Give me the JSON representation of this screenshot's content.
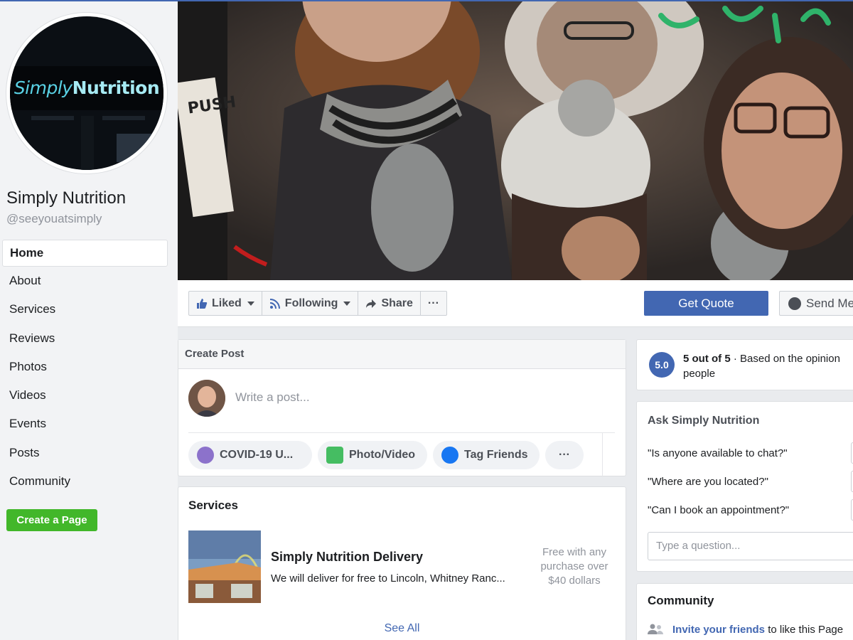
{
  "page": {
    "name": "Simply Nutrition",
    "handle": "@seeyouatsimply",
    "logo_text_part1": "Simply",
    "logo_text_part2": "Nutrition"
  },
  "nav": {
    "items": [
      {
        "label": "Home",
        "active": true
      },
      {
        "label": "About"
      },
      {
        "label": "Services"
      },
      {
        "label": "Reviews"
      },
      {
        "label": "Photos"
      },
      {
        "label": "Videos"
      },
      {
        "label": "Events"
      },
      {
        "label": "Posts"
      },
      {
        "label": "Community"
      }
    ],
    "create_page": "Create a Page"
  },
  "cover": {
    "door_sign": "PUSH"
  },
  "actions": {
    "liked": "Liked",
    "following": "Following",
    "share": "Share",
    "more": "···",
    "get_quote": "Get Quote",
    "send_message": "Send Me"
  },
  "create_post": {
    "title": "Create Post",
    "placeholder": "Write a post...",
    "pills": [
      {
        "label": "COVID-19 U...",
        "icon": "heart-icon",
        "color": "#8c72cb"
      },
      {
        "label": "Photo/Video",
        "icon": "photo-icon",
        "color": "#45bd62"
      },
      {
        "label": "Tag Friends",
        "icon": "tag-friends-icon",
        "color": "#1877f2"
      },
      {
        "label": "···",
        "icon": "more-icon"
      }
    ]
  },
  "services": {
    "title": "Services",
    "item": {
      "name": "Simply Nutrition Delivery",
      "description": "We will deliver for free to Lincoln, Whitney Ranc...",
      "price": "Free with any purchase over $40 dollars"
    },
    "see_all": "See All"
  },
  "rating": {
    "score": "5.0",
    "headline": "5 out of 5",
    "detail": " · Based on the opinion",
    "detail2": "people"
  },
  "ask": {
    "title": "Ask Simply Nutrition",
    "questions": [
      "\"Is anyone available to chat?\"",
      "\"Where are you located?\"",
      "\"Can I book an appointment?\""
    ],
    "input_placeholder": "Type a question..."
  },
  "community": {
    "title": "Community",
    "invite_link": "Invite your friends",
    "invite_rest": " to like this Page"
  },
  "colors": {
    "brand": "#4267b2",
    "create_page": "#42b72a"
  }
}
